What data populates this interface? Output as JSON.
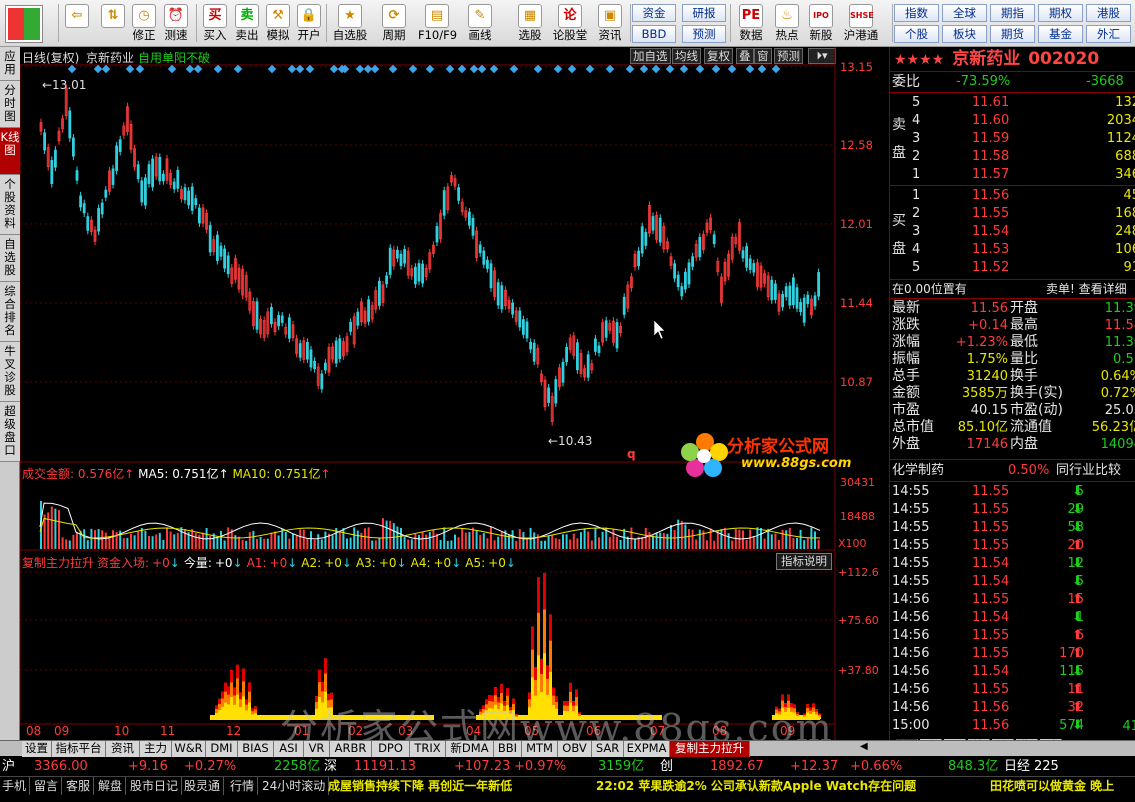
{
  "toolbar": {
    "buttons": [
      {
        "icon": "back-arrow-icon",
        "label": ""
      },
      {
        "icon": "updown-icon",
        "label": ""
      },
      {
        "icon": "clock-icon",
        "label": "修正"
      },
      {
        "icon": "alarm-icon",
        "label": "测速"
      },
      {
        "icon": "buy-icon",
        "glyph": "买",
        "label": "买入"
      },
      {
        "icon": "sell-icon",
        "glyph": "卖",
        "label": "卖出"
      },
      {
        "icon": "hammer-icon",
        "label": "模拟"
      },
      {
        "icon": "lock-icon",
        "label": "开户"
      },
      {
        "icon": "star-icon",
        "label": "自选股"
      },
      {
        "icon": "period-icon",
        "label": "周期"
      },
      {
        "icon": "f10-icon",
        "label": "F10/F9"
      },
      {
        "icon": "pen-icon",
        "label": "画线"
      },
      {
        "icon": "screen-icon",
        "label": "选股"
      },
      {
        "icon": "lun-icon",
        "glyph": "论",
        "label": "论股堂"
      },
      {
        "icon": "info-icon",
        "label": "资讯"
      },
      {
        "icon": "pe-icon",
        "glyph": "PE",
        "label": "数据"
      },
      {
        "icon": "hot-icon",
        "label": "热点"
      },
      {
        "icon": "ipo-icon",
        "glyph": "IPO",
        "label": "新股"
      },
      {
        "icon": "hk-icon",
        "glyph": "SHSE",
        "label": "沪港通"
      }
    ],
    "small_buttons": [
      [
        "资金",
        "研报"
      ],
      [
        "BBD",
        "预测"
      ],
      [
        "指数",
        "全球",
        "期指",
        "期权",
        "港股"
      ],
      [
        "个股",
        "板块",
        "期货",
        "基金",
        "外汇"
      ]
    ]
  },
  "left_tabs": [
    "应用",
    "分时图",
    "K线图",
    "个股资料",
    "自选股",
    "综合排名",
    "牛叉诊股",
    "超级盘口"
  ],
  "chart": {
    "header_left": "日线(复权)",
    "stock_name": "京新药业",
    "formula_name": "自用单阳不破",
    "header_buttons": [
      "加自选",
      "均线",
      "复权",
      "叠",
      "窗",
      "预测"
    ],
    "price_axis": [
      "13.15",
      "12.58",
      "12.01",
      "11.44",
      "10.87"
    ],
    "high_label": "13.01",
    "low_label": "10.43",
    "q_mark": "q",
    "date_axis": [
      "08",
      "09",
      "10",
      "11",
      "12",
      "01",
      "02",
      "03",
      "04",
      "05",
      "06",
      "07",
      "08",
      "09"
    ],
    "volume": {
      "label": "成交金额:",
      "value": "0.576亿",
      "ma5_label": "MA5:",
      "ma5": "0.751亿",
      "ma10_label": "MA10:",
      "ma10": "0.751亿",
      "axis": [
        "30431",
        "18488"
      ],
      "unit": "X100"
    },
    "indicator": {
      "name": "复制主力拉升",
      "fund_label": "资金入场:",
      "fund": "+0",
      "today_label": "今量:",
      "today": "+0",
      "a1_label": "A1:",
      "a1": "+0",
      "a2_label": "A2:",
      "a2": "+0",
      "a3_label": "A3:",
      "a3": "+0",
      "a4_label": "A4:",
      "a4": "+0",
      "a5_label": "A5:",
      "a5": "+0",
      "help": "指标说明",
      "axis": [
        "+112.6",
        "+75.60",
        "+37.80"
      ]
    },
    "watermark": "分析家公式网www.88gs.com",
    "logo_text": "分析家公式网",
    "logo_url": "www.88gs.com"
  },
  "right_panel": {
    "stars": "★★★★",
    "name": "京新药业",
    "code": "002020",
    "wei_bi_label": "委比",
    "wei_bi": "-73.59%",
    "wei_cha": "-3668",
    "sell_label": "卖盘",
    "buy_label": "买盘",
    "asks": [
      {
        "lvl": "5",
        "price": "11.61",
        "vol": "132"
      },
      {
        "lvl": "4",
        "price": "11.60",
        "vol": "2034"
      },
      {
        "lvl": "3",
        "price": "11.59",
        "vol": "1124"
      },
      {
        "lvl": "2",
        "price": "11.58",
        "vol": "688"
      },
      {
        "lvl": "1",
        "price": "11.57",
        "vol": "346"
      }
    ],
    "bids": [
      {
        "lvl": "1",
        "price": "11.56",
        "vol": "45"
      },
      {
        "lvl": "2",
        "price": "11.55",
        "vol": "168"
      },
      {
        "lvl": "3",
        "price": "11.54",
        "vol": "248"
      },
      {
        "lvl": "4",
        "price": "11.53",
        "vol": "106"
      },
      {
        "lvl": "5",
        "price": "11.52",
        "vol": "91"
      }
    ],
    "note_left": "在0.00位置有",
    "note_right": "卖单! 查看详细",
    "quote": [
      [
        "最新",
        "11.56",
        "r",
        "开盘",
        "11.39",
        "g"
      ],
      [
        "涨跌",
        "+0.14",
        "r",
        "最高",
        "11.58",
        "r"
      ],
      [
        "涨幅",
        "+1.23%",
        "r",
        "最低",
        "11.36",
        "g"
      ],
      [
        "振幅",
        "1.75%",
        "y",
        "量比",
        "0.51",
        "g"
      ],
      [
        "总手",
        "31240",
        "y",
        "换手",
        "0.64%",
        "y"
      ],
      [
        "金额",
        "3585万",
        "y",
        "换手(实)",
        "0.72%",
        "y"
      ],
      [
        "市盈",
        "40.15",
        "w",
        "市盈(动)",
        "25.03",
        "w"
      ],
      [
        "总市值",
        "85.10亿",
        "y",
        "流通值",
        "56.23亿",
        "y"
      ],
      [
        "外盘",
        "17146",
        "r",
        "内盘",
        "14094",
        "g"
      ]
    ],
    "sector_name": "化学制药",
    "sector_change": "0.50%",
    "sector_compare": "同行业比较",
    "ticks": [
      [
        "14:55",
        "11.55",
        "5",
        "down"
      ],
      [
        "14:55",
        "11.55",
        "29",
        "down"
      ],
      [
        "14:55",
        "11.55",
        "53",
        "down"
      ],
      [
        "14:55",
        "11.55",
        "20",
        "up"
      ],
      [
        "14:55",
        "11.54",
        "12",
        "down"
      ],
      [
        "14:55",
        "11.54",
        "5",
        "down"
      ],
      [
        "14:56",
        "11.55",
        "15",
        "up"
      ],
      [
        "14:56",
        "11.54",
        "1",
        "down"
      ],
      [
        "14:56",
        "11.55",
        "6",
        "up"
      ],
      [
        "14:56",
        "11.55",
        "170",
        "up"
      ],
      [
        "14:56",
        "11.54",
        "115",
        "down"
      ],
      [
        "14:56",
        "11.55",
        "11",
        "up"
      ],
      [
        "14:56",
        "11.56",
        "32",
        "up"
      ],
      [
        "15:00",
        "11.56",
        "574",
        "down"
      ]
    ],
    "tick_tail": "41",
    "bottom_tabs": [
      "细",
      "诊",
      "分",
      "筹",
      "馅",
      "指",
      "财"
    ]
  },
  "bottom_tabs": [
    "设置",
    "指标平台",
    "资讯",
    "主力",
    "W&R",
    "DMI",
    "BIAS",
    "ASI",
    "VR",
    "ARBR",
    "DPO",
    "TRIX",
    "新DMA",
    "BBI",
    "MTM",
    "OBV",
    "SAR",
    "EXPMA",
    "复制主力拉升"
  ],
  "status1": {
    "sh_label": "沪",
    "sh": "3366.00",
    "sh_chg": "+9.16",
    "sh_pct": "+0.27%",
    "sh_amt": "2258亿",
    "sz_label": "深",
    "sz": "11191.13",
    "sz_chg": "+107.23",
    "sz_pct": "+0.97%",
    "sz_amt": "3159亿",
    "cy_label": "创",
    "cy": "1892.67",
    "cy_chg": "+12.37",
    "cy_pct": "+0.66%",
    "amt2": "848.3亿",
    "rj_label": "日经",
    "rj": "225"
  },
  "status2": {
    "items": [
      "手机",
      "留言",
      "客服",
      "解盘",
      "股市日记",
      "股灵通",
      "行情",
      "24小时滚动"
    ],
    "news1": "成屋销售持续下降 再创近一年新低",
    "news2": "22:02 苹果跌逾2% 公司承认新款Apple Watch存在问题",
    "news3": "田花喷可以做黄金 晚上"
  },
  "colors": {
    "up": "#ff3b3b",
    "down": "#00e0e0",
    "accent": "#b00000",
    "ma": "#e8e800",
    "diamond": "#3aa6e8"
  }
}
